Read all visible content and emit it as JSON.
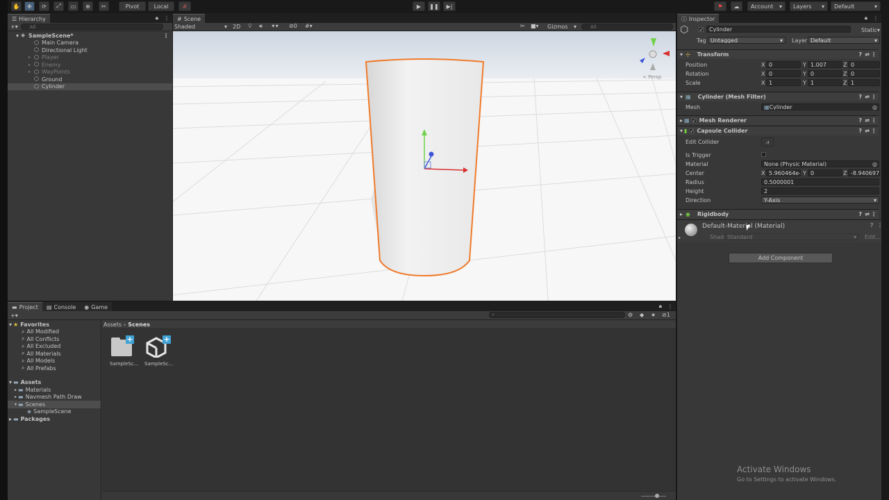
{
  "toolbar": {
    "tools": [
      "hand-icon",
      "move-icon",
      "rotate-icon",
      "scale-icon",
      "rect-icon",
      "transform-icon",
      "custom-tool-icon"
    ],
    "pivot": "Pivot",
    "local": "Local",
    "account": "Account",
    "layers": "Layers",
    "layout": "Default"
  },
  "hierarchy": {
    "tab": "Hierarchy",
    "search": "All",
    "scene": "SampleScene*",
    "items": [
      {
        "label": "Main Camera",
        "dim": false
      },
      {
        "label": "Directional Light",
        "dim": false
      },
      {
        "label": "Player",
        "dim": true
      },
      {
        "label": "Enemy",
        "dim": true
      },
      {
        "label": "WayPoints",
        "dim": true
      },
      {
        "label": "Ground",
        "dim": false
      },
      {
        "label": "Cylinder",
        "dim": false
      }
    ]
  },
  "scene": {
    "tab": "Scene",
    "shading": "Shaded",
    "mode2d": "2D",
    "hidden_count": "0",
    "gizmos": "Gizmos",
    "search": "All",
    "persp": "< Persp"
  },
  "inspector": {
    "tab": "Inspector",
    "object": "Cylinder",
    "static": "Static",
    "tag_label": "Tag",
    "tag": "Untagged",
    "layer_label": "Layer",
    "layer": "Default",
    "transform": {
      "title": "Transform",
      "rows": [
        {
          "label": "Position",
          "x": "0",
          "y": "1.007",
          "z": "0"
        },
        {
          "label": "Rotation",
          "x": "0",
          "y": "0",
          "z": "0"
        },
        {
          "label": "Scale",
          "x": "1",
          "y": "1",
          "z": "1"
        }
      ]
    },
    "mesh_filter": {
      "title": "Cylinder (Mesh Filter)",
      "mesh_label": "Mesh",
      "mesh": "Cylinder"
    },
    "mesh_renderer": {
      "title": "Mesh Renderer"
    },
    "capsule": {
      "title": "Capsule Collider",
      "edit_label": "Edit Collider",
      "trigger_label": "Is Trigger",
      "material_label": "Material",
      "material": "None (Physic Material)",
      "center_label": "Center",
      "cx": "5.960464e-",
      "cy": "0",
      "cz": "-8.940697e",
      "radius_label": "Radius",
      "radius": "0.5000001",
      "height_label": "Height",
      "height": "2",
      "direction_label": "Direction",
      "direction": "Y-Axis"
    },
    "rigidbody": {
      "title": "Rigidbody"
    },
    "material": {
      "title": "Default-Material (Material)",
      "shader_label": "Shader",
      "shader": "Standard",
      "edit": "Edit..."
    },
    "add_component": "Add Component",
    "axis": {
      "x": "X",
      "y": "Y",
      "z": "Z"
    }
  },
  "project": {
    "tabs": [
      "Project",
      "Console",
      "Game"
    ],
    "favorites": "Favorites",
    "fav_items": [
      "All Modified",
      "All Conflicts",
      "All Excluded",
      "All Materials",
      "All Models",
      "All Prefabs"
    ],
    "assets": "Assets",
    "asset_items": [
      "Materials",
      "Navmesh Path Draw",
      "Scenes"
    ],
    "scene_child": "SampleScene",
    "packages": "Packages",
    "breadcrumb": [
      "Assets",
      "Scenes"
    ],
    "files": [
      {
        "label": "SampleSc...",
        "icon": "folder-icon"
      },
      {
        "label": "SampleSc...",
        "icon": "unity-scene-icon"
      }
    ],
    "hidden_count": "1"
  },
  "watermark": {
    "line1": "Activate Windows",
    "line2": "Go to Settings to activate Windows."
  },
  "colors": {
    "accent": "#46607c",
    "selection_outline": "#f07a2a",
    "panel": "#383838"
  }
}
